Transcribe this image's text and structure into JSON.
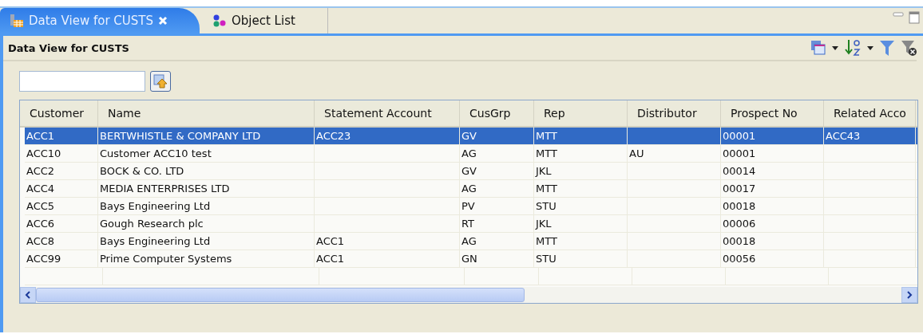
{
  "tabs": [
    {
      "label": "Data View for CUSTS",
      "selected": true,
      "closable": true
    },
    {
      "label": "Object List",
      "selected": false,
      "closable": false
    }
  ],
  "view_title": "Data View for CUSTS",
  "table": {
    "columns": [
      "Customer",
      "Name",
      "Statement Account",
      "CusGrp",
      "Rep",
      "Distributor",
      "Prospect No",
      "Related Acco"
    ],
    "rows": [
      {
        "selected": true,
        "cells": [
          "ACC1",
          "BERTWHISTLE & COMPANY LTD",
          "ACC23",
          "GV",
          "MTT",
          "",
          "00001",
          "ACC43"
        ]
      },
      {
        "selected": false,
        "cells": [
          "ACC10",
          "Customer ACC10 test",
          "",
          "AG",
          "MTT",
          "AU",
          "00001",
          ""
        ]
      },
      {
        "selected": false,
        "cells": [
          "ACC2",
          "BOCK & CO. LTD",
          "",
          "GV",
          "JKL",
          "",
          "00014",
          ""
        ]
      },
      {
        "selected": false,
        "cells": [
          "ACC4",
          "MEDIA ENTERPRISES LTD",
          "",
          "AG",
          "MTT",
          "",
          "00017",
          ""
        ]
      },
      {
        "selected": false,
        "cells": [
          "ACC5",
          "Bays Engineering Ltd",
          "",
          "PV",
          "STU",
          "",
          "00018",
          ""
        ]
      },
      {
        "selected": false,
        "cells": [
          "ACC6",
          "Gough Research plc",
          "",
          "RT",
          "JKL",
          "",
          "00006",
          ""
        ]
      },
      {
        "selected": false,
        "cells": [
          "ACC8",
          "Bays Engineering Ltd",
          "ACC1",
          "AG",
          "MTT",
          "",
          "00018",
          ""
        ]
      },
      {
        "selected": false,
        "cells": [
          "ACC99",
          "Prime Computer Systems",
          "ACC1",
          "GN",
          "STU",
          "",
          "00056",
          ""
        ]
      }
    ]
  }
}
